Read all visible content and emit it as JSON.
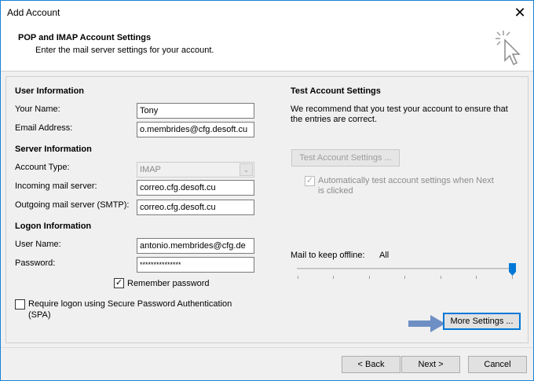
{
  "window": {
    "title": "Add Account",
    "close_glyph": "✕"
  },
  "header": {
    "title": "POP and IMAP Account Settings",
    "subtitle": "Enter the mail server settings for your account.",
    "icon": "cursor-click-icon"
  },
  "user_info": {
    "heading": "User Information",
    "name_label": "Your Name:",
    "name_value": "Tony",
    "email_label": "Email Address:",
    "email_value": "o.membrides@cfg.desoft.cu"
  },
  "server_info": {
    "heading": "Server Information",
    "account_type_label": "Account Type:",
    "account_type_value": "IMAP",
    "incoming_label": "Incoming mail server:",
    "incoming_value": "correo.cfg.desoft.cu",
    "outgoing_label": "Outgoing mail server (SMTP):",
    "outgoing_value": "correo.cfg.desoft.cu"
  },
  "logon_info": {
    "heading": "Logon Information",
    "username_label": "User Name:",
    "username_value": "antonio.membrides@cfg.de",
    "password_label": "Password:",
    "password_value": "***************",
    "remember_label": "Remember password",
    "remember_checked": true,
    "spa_label_line1": "Require logon using Secure Password Authentication",
    "spa_label_line2": "(SPA)",
    "spa_checked": false
  },
  "test_settings": {
    "heading": "Test Account Settings",
    "desc_line1": "We recommend that you test your account to ensure that",
    "desc_line2": "the entries are correct.",
    "test_button": "Test Account Settings ...",
    "auto_label_line1": "Automatically test account settings when Next",
    "auto_label_line2": "is clicked",
    "auto_checked": true
  },
  "offline": {
    "label": "Mail to keep offline:",
    "value": "All",
    "slider_fraction": 1.0
  },
  "more_settings_button": "More Settings ...",
  "footer": {
    "back": "< Back",
    "next": "Next >",
    "cancel": "Cancel"
  },
  "colors": {
    "accent": "#0078d7",
    "annotation_arrow": "#6d8fc4"
  }
}
